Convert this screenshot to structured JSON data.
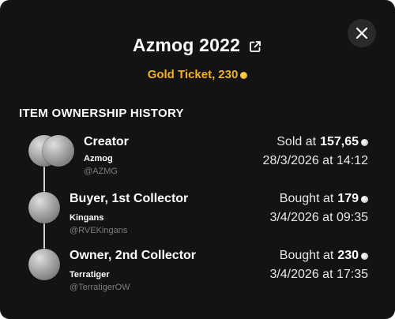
{
  "header": {
    "title": "Azmog 2022",
    "ticket_label": "Gold Ticket,",
    "ticket_value": "230"
  },
  "section_title": "ITEM OWNERSHIP HISTORY",
  "history": [
    {
      "role": "Creator",
      "name": "Azmog",
      "handle": "@AZMG",
      "price_label": "Sold at",
      "price_value": "157,65",
      "date": "28/3/2026 at 14:12"
    },
    {
      "role": "Buyer, 1st Collector",
      "name": "Kingans",
      "handle": "@RVEKingans",
      "price_label": "Bought at",
      "price_value": "179",
      "date": "3/4/2026 at 09:35"
    },
    {
      "role": "Owner, 2nd Collector",
      "name": "Terratiger",
      "handle": "@TerratigerOW",
      "price_label": "Bought at",
      "price_value": "230",
      "date": "3/4/2026 at 17:35"
    }
  ],
  "icons": {
    "close": "close-icon",
    "external_link": "external-link-icon",
    "gold_coin": "gold-coin-icon",
    "silver_coin": "silver-coin-icon"
  },
  "colors": {
    "background": "#131313",
    "accent_gold": "#f2b31c",
    "handle_gray": "#7d7d7d"
  }
}
